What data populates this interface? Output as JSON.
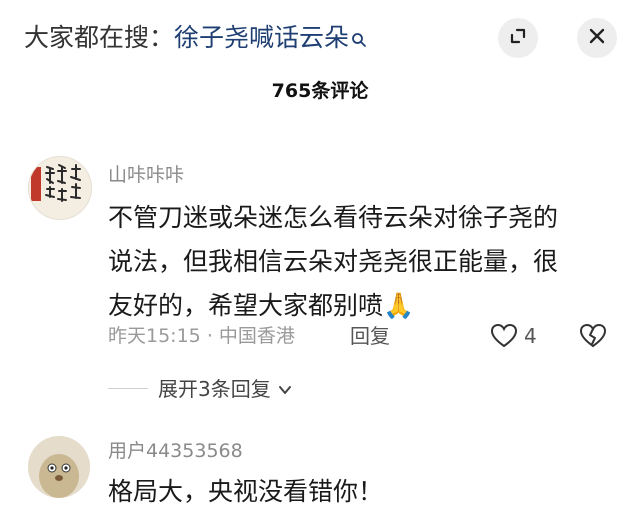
{
  "header": {
    "search_label": "大家都在搜：",
    "search_keyword": "徐子尧喊话云朵",
    "comment_count_title": "765条评论"
  },
  "comments": [
    {
      "username": "山咔咔咔",
      "content_lines": [
        "不管刀迷或朵迷怎么看待云朵对徐子尧的",
        "说法，但我相信云朵对尧尧很正能量，很",
        "友好的，希望大家都别喷"
      ],
      "emoji": "🙏",
      "time": "昨天15:15",
      "separator": "·",
      "location": "中国香港",
      "reply_label": "回复",
      "like_count": "4",
      "expand_replies_label": "展开3条回复"
    },
    {
      "username": "用户44353568",
      "content": "格局大，央视没看错你！"
    }
  ],
  "colors": {
    "keyword": "#1f3f73",
    "meta_gray": "#9a9a9a",
    "button_bg": "#eeeeee"
  }
}
